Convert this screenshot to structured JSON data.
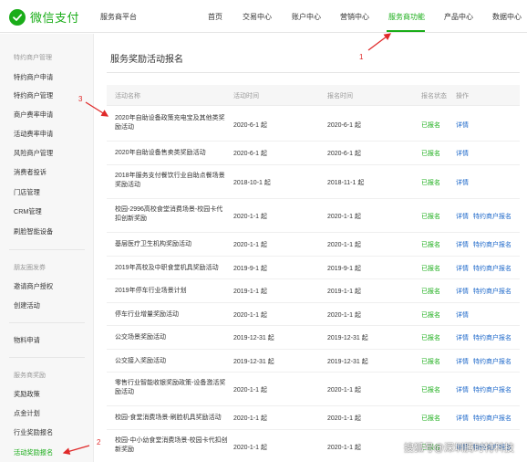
{
  "brand": {
    "logo_text": "微信支付",
    "platform": "服务商平台",
    "accent": "#1aad19",
    "link_color": "#1a66c9"
  },
  "topnav": [
    {
      "label": "首页"
    },
    {
      "label": "交易中心"
    },
    {
      "label": "账户中心"
    },
    {
      "label": "营销中心"
    },
    {
      "label": "服务商功能",
      "active": true
    },
    {
      "label": "产品中心"
    },
    {
      "label": "数据中心"
    }
  ],
  "sidebar": {
    "groups": [
      {
        "title": "特约商户管理",
        "items": [
          "特约商户申请",
          "特约商户管理",
          "商户费率申请",
          "活动费率申请",
          "风险商户管理",
          "消费者投诉",
          "门店管理",
          "CRM管理",
          "刷脸智能设备"
        ]
      },
      {
        "title": "朋友圈发券",
        "items": [
          "邀请商户授权",
          "创建活动"
        ]
      },
      {
        "title": "",
        "items": [
          "物料申请"
        ]
      },
      {
        "title": "服务商奖励",
        "items": [
          "奖励政策",
          "点金计划",
          "行业奖励报名",
          "活动奖励报名"
        ]
      }
    ],
    "active_item": "活动奖励报名"
  },
  "main": {
    "title": "服务奖励活动报名",
    "columns": [
      "活动名称",
      "活动时间",
      "报名时间",
      "报名状态",
      "操作"
    ],
    "rows": [
      {
        "name": "2020年自助设备政策充电宝及其他类奖励活动",
        "activity_time": "2020-6-1 起",
        "signup_time": "2020-6-1 起",
        "status": "已报名",
        "ops": [
          "详情"
        ]
      },
      {
        "name": "2020年自助设备售卖类奖励活动",
        "activity_time": "2020-6-1 起",
        "signup_time": "2020-6-1 起",
        "status": "已报名",
        "ops": [
          "详情"
        ]
      },
      {
        "name": "2018年服务支付餐饮行业自助点餐场景奖励活动",
        "activity_time": "2018-10-1 起",
        "signup_time": "2018-11-1 起",
        "status": "已报名",
        "ops": [
          "详情"
        ]
      },
      {
        "name": "校园-2996高校食堂消费场景-校园卡代扣创新奖励",
        "activity_time": "2020-1-1 起",
        "signup_time": "2020-1-1 起",
        "status": "已报名",
        "ops": [
          "详情",
          "特约商户报名"
        ]
      },
      {
        "name": "基层医疗卫生机构奖励活动",
        "activity_time": "2020-1-1 起",
        "signup_time": "2020-1-1 起",
        "status": "已报名",
        "ops": [
          "详情",
          "特约商户报名"
        ]
      },
      {
        "name": "2019年高校及中职食堂机具奖励活动",
        "activity_time": "2019-9-1 起",
        "signup_time": "2019-9-1 起",
        "status": "已报名",
        "ops": [
          "详情",
          "特约商户报名"
        ]
      },
      {
        "name": "2019年停车行业场景计划",
        "activity_time": "2019-1-1 起",
        "signup_time": "2019-1-1 起",
        "status": "已报名",
        "ops": [
          "详情",
          "特约商户报名"
        ]
      },
      {
        "name": "停车行业增量奖励活动",
        "activity_time": "2020-1-1 起",
        "signup_time": "2020-1-1 起",
        "status": "已报名",
        "ops": [
          "详情"
        ]
      },
      {
        "name": "公交场景奖励活动",
        "activity_time": "2019-12-31 起",
        "signup_time": "2019-12-31 起",
        "status": "已报名",
        "ops": [
          "详情",
          "特约商户报名"
        ]
      },
      {
        "name": "公交接入奖励活动",
        "activity_time": "2019-12-31 起",
        "signup_time": "2019-12-31 起",
        "status": "已报名",
        "ops": [
          "详情",
          "特约商户报名"
        ]
      },
      {
        "name": "零售行业智能收银奖励政策-设备激活奖励活动",
        "activity_time": "2020-1-1 起",
        "signup_time": "2020-1-1 起",
        "status": "已报名",
        "ops": [
          "详情",
          "特约商户报名"
        ]
      },
      {
        "name": "校园-食堂消费场景-刷脸机具奖励活动",
        "activity_time": "2020-1-1 起",
        "signup_time": "2020-1-1 起",
        "status": "已报名",
        "ops": [
          "详情",
          "特约商户报名"
        ]
      },
      {
        "name": "校园-中小幼食堂消费场景-校园卡代扣创新奖励",
        "activity_time": "2020-1-1 起",
        "signup_time": "2020-1-1 起",
        "status": "已报名",
        "ops": [
          "详情",
          "特约商户报名"
        ]
      }
    ]
  },
  "annotations": {
    "num1": "1",
    "num2": "2",
    "num3": "3",
    "color": "#e02a2a"
  },
  "watermark": "搜狐号@深圳腾时特科技"
}
